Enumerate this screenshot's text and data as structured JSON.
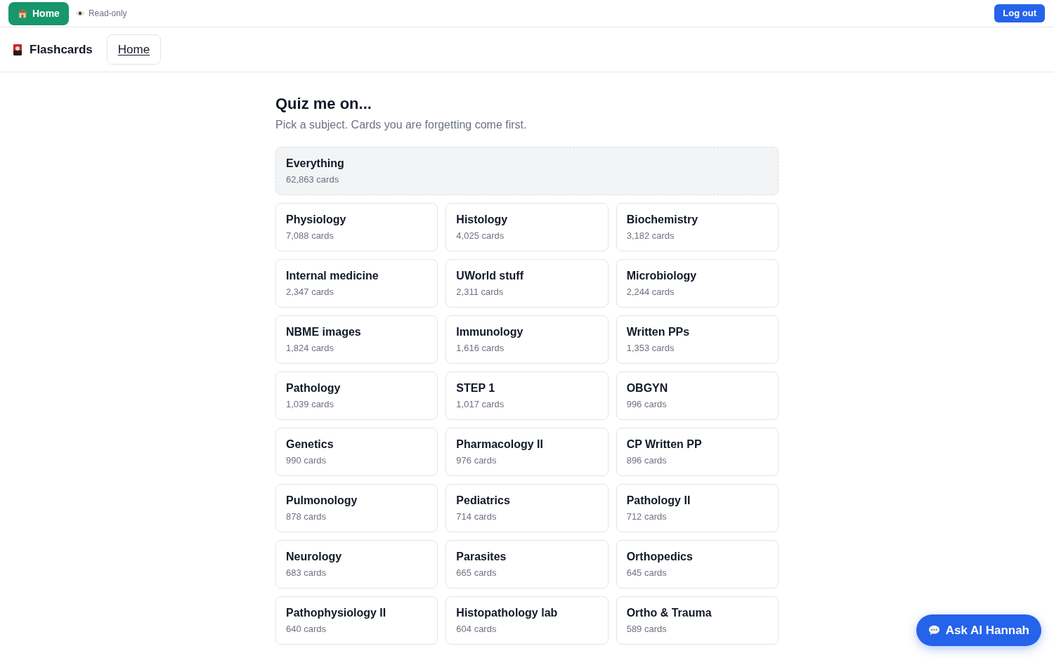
{
  "top_bar": {
    "home_button": {
      "label": "Home"
    },
    "mode_label": "Read-only",
    "logout_button": {
      "label": "Log out"
    }
  },
  "nav": {
    "brand": "Flashcards",
    "links": [
      {
        "label": "Home",
        "selected": true
      }
    ]
  },
  "header": {
    "title": "Quiz me on...",
    "subtitle": "Pick a subject. Cards you are forgetting come first."
  },
  "subjects": [
    {
      "kind": "all",
      "name": "Everything",
      "count": "62,863 cards"
    },
    {
      "kind": "subject",
      "name": "Physiology",
      "count": "7,088 cards"
    },
    {
      "kind": "subject",
      "name": "Histology",
      "count": "4,025 cards"
    },
    {
      "kind": "subject",
      "name": "Biochemistry",
      "count": "3,182 cards"
    },
    {
      "kind": "subject",
      "name": "Internal medicine",
      "count": "2,347 cards"
    },
    {
      "kind": "subject",
      "name": "UWorld stuff",
      "count": "2,311 cards"
    },
    {
      "kind": "subject",
      "name": "Microbiology",
      "count": "2,244 cards"
    },
    {
      "kind": "subject",
      "name": "NBME images",
      "count": "1,824 cards"
    },
    {
      "kind": "subject",
      "name": "Immunology",
      "count": "1,616 cards"
    },
    {
      "kind": "subject",
      "name": "Written PPs",
      "count": "1,353 cards"
    },
    {
      "kind": "subject",
      "name": "Pathology",
      "count": "1,039 cards"
    },
    {
      "kind": "subject",
      "name": "STEP 1",
      "count": "1,017 cards"
    },
    {
      "kind": "subject",
      "name": "OBGYN",
      "count": "996 cards"
    },
    {
      "kind": "subject",
      "name": "Genetics",
      "count": "990 cards"
    },
    {
      "kind": "subject",
      "name": "Pharmacology II",
      "count": "976 cards"
    },
    {
      "kind": "subject",
      "name": "CP Written PP",
      "count": "896 cards"
    },
    {
      "kind": "subject",
      "name": "Pulmonology",
      "count": "878 cards"
    },
    {
      "kind": "subject",
      "name": "Pediatrics",
      "count": "714 cards"
    },
    {
      "kind": "subject",
      "name": "Pathology II",
      "count": "712 cards"
    },
    {
      "kind": "subject",
      "name": "Neurology",
      "count": "683 cards"
    },
    {
      "kind": "subject",
      "name": "Parasites",
      "count": "665 cards"
    },
    {
      "kind": "subject",
      "name": "Orthopedics",
      "count": "645 cards"
    },
    {
      "kind": "subject",
      "name": "Pathophysiology II",
      "count": "640 cards"
    },
    {
      "kind": "subject",
      "name": "Histopathology lab",
      "count": "604 cards"
    },
    {
      "kind": "subject",
      "name": "Ortho & Trauma",
      "count": "589 cards"
    }
  ],
  "chat_button": {
    "label": "Ask AI Hannah"
  }
}
